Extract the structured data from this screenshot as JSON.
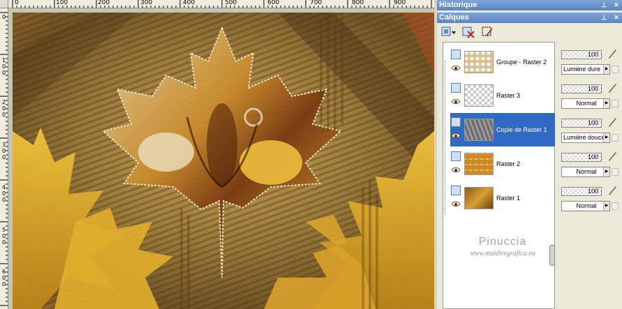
{
  "ruler_top": {
    "labels": [
      "0",
      "100",
      "200",
      "300",
      "400",
      "500",
      "600",
      "700",
      "800",
      "900"
    ]
  },
  "ruler_left": {
    "labels": [
      "0",
      "1 0 0",
      "2 0 0",
      "3 0 0",
      "4 0 0",
      "5 0 0",
      "6 0 0"
    ]
  },
  "panels": {
    "history": {
      "title": "Historique"
    },
    "layers": {
      "title": "Calques",
      "layers": [
        {
          "name": "Groupe - Raster 2",
          "opacity": "100",
          "blend_mode": "Lumière dure"
        },
        {
          "name": "Raster 3",
          "opacity": "100",
          "blend_mode": "Normal"
        },
        {
          "name": "Copie de Raster 1",
          "opacity": "100",
          "blend_mode": "Lumière douce",
          "selected": true
        },
        {
          "name": "Raster 2",
          "opacity": "100",
          "blend_mode": "Normal"
        },
        {
          "name": "Raster 1",
          "opacity": "100",
          "blend_mode": "Normal"
        }
      ]
    }
  },
  "watermark": {
    "name": "Pinuccia",
    "url": "www.maidiregrafica.eu"
  },
  "colors": {
    "titlebar": "#6b93cf",
    "selection": "#316ac5",
    "panel_bg": "#ece9d8"
  },
  "icons": [
    "pin-icon",
    "close-icon",
    "new-layer-icon",
    "delete-layer-icon",
    "mask-icon",
    "eye-icon",
    "paintbrush-icon",
    "lock-icon"
  ]
}
